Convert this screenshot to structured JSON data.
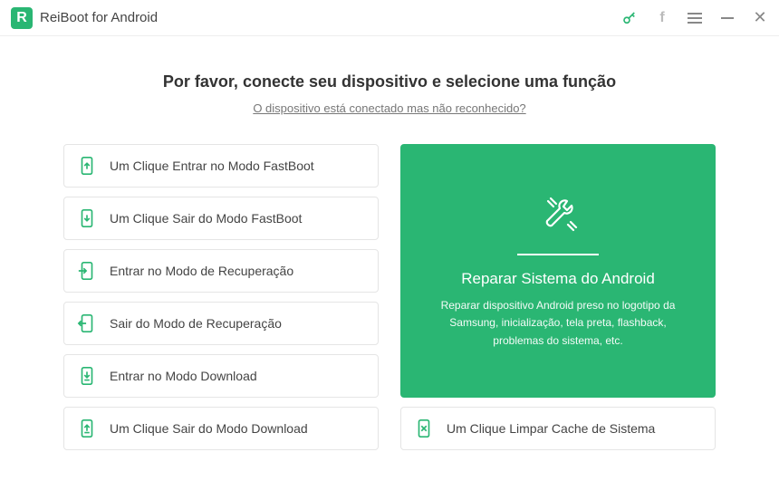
{
  "app": {
    "title": "ReiBoot for Android"
  },
  "main": {
    "heading": "Por favor, conecte seu dispositivo e selecione uma função",
    "sublink": "O dispositivo está conectado mas não reconhecido?"
  },
  "options": {
    "fastboot_enter": "Um Clique Entrar no Modo FastBoot",
    "fastboot_exit": "Um Clique Sair do Modo FastBoot",
    "recovery_enter": "Entrar no Modo de Recuperação",
    "recovery_exit": "Sair do Modo de Recuperação",
    "download_enter": "Entrar no Modo Download",
    "download_exit": "Um Clique Sair do Modo Download",
    "clear_cache": "Um Clique Limpar Cache de Sistema"
  },
  "repair": {
    "title": "Reparar Sistema do Android",
    "desc": "Reparar dispositivo Android preso no logotipo da Samsung, inicialização, tela preta, flashback, problemas do sistema, etc."
  },
  "colors": {
    "accent": "#2ab673"
  }
}
